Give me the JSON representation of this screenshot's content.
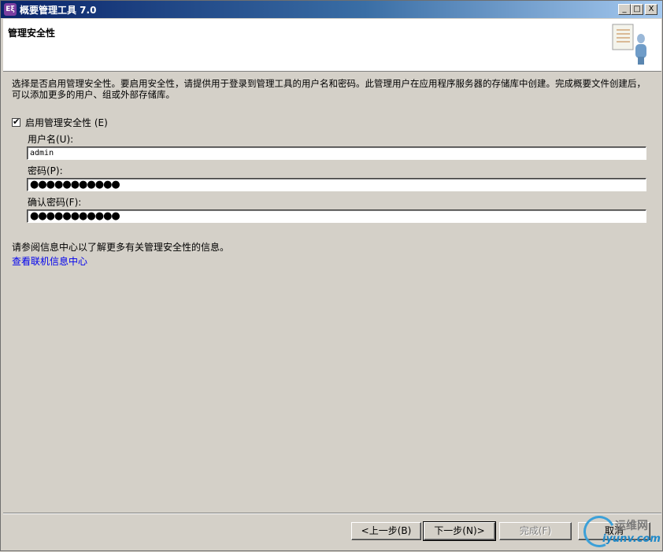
{
  "window": {
    "app_icon_text": "Eξ",
    "title": "概要管理工具 7.0",
    "minimize": "_",
    "maximize": "□",
    "close": "X"
  },
  "header": {
    "title": "管理安全性",
    "image_icon": "security-user-icon"
  },
  "description": "选择是否启用管理安全性。要启用安全性，请提供用于登录到管理工具的用户名和密码。此管理用户在应用程序服务器的存储库中创建。完成概要文件创建后，可以添加更多的用户、组或外部存储库。",
  "enable_security": {
    "label": "启用管理安全性 (E)",
    "checked": true,
    "check_mark": "✔"
  },
  "form": {
    "username_label": "用户名(U):",
    "username_value": "admin",
    "password_label": "密码(P):",
    "password_value": "●●●●●●●●●●●",
    "confirm_label": "确认密码(F):",
    "confirm_value": "●●●●●●●●●●●"
  },
  "info_text": "请参阅信息中心以了解更多有关管理安全性的信息。",
  "info_link": "查看联机信息中心",
  "buttons": {
    "back": "<上一步(B)",
    "next": "下一步(N)>",
    "finish": "完成(F)",
    "cancel": "取消"
  },
  "watermark": {
    "line1": "运维网",
    "line2": "iyunv.com"
  },
  "colors": {
    "titlebar_start": "#0a246a",
    "titlebar_end": "#a6caf0",
    "dialog_bg": "#d4d0c8",
    "link": "#0000ee"
  }
}
